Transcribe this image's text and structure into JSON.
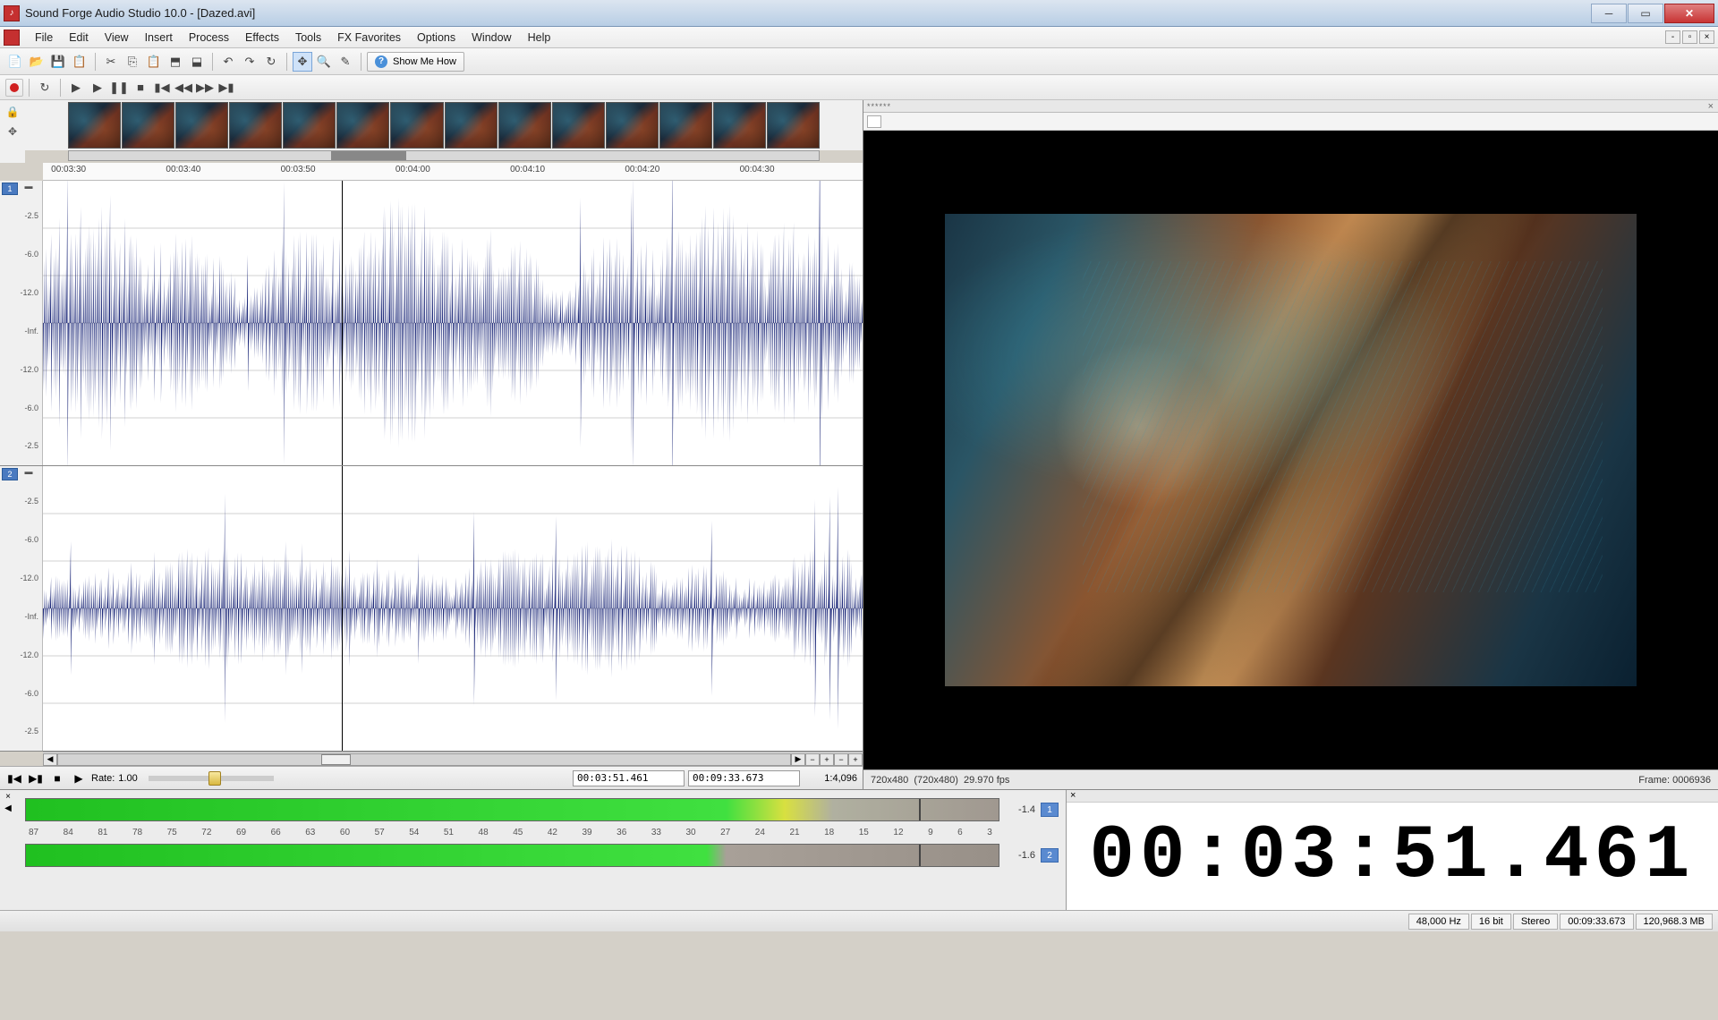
{
  "title": "Sound Forge Audio Studio 10.0 - [Dazed.avi]",
  "menu": [
    "File",
    "Edit",
    "View",
    "Insert",
    "Process",
    "Effects",
    "Tools",
    "FX Favorites",
    "Options",
    "Window",
    "Help"
  ],
  "toolbar": {
    "show_me_how": "Show Me How"
  },
  "timeline": {
    "ticks": [
      "00:03:30",
      "00:03:40",
      "00:03:50",
      "00:04:00",
      "00:04:10",
      "00:04:20",
      "00:04:30"
    ]
  },
  "dbscale": [
    "-2.5",
    "-6.0",
    "-12.0",
    "-Inf.",
    "-12.0",
    "-6.0",
    "-2.5"
  ],
  "channels": [
    "1",
    "2"
  ],
  "navbar": {
    "rate_label": "Rate:",
    "rate_value": "1.00",
    "pos_time": "00:03:51.461",
    "total_time": "00:09:33.673",
    "zoom": "1:4,096"
  },
  "video": {
    "header": "******",
    "res": "720x480",
    "res2": "(720x480)",
    "fps": "29.970 fps",
    "frame_label": "Frame:",
    "frame": "0006936"
  },
  "meters": {
    "peak1": "-1.4",
    "peak2": "-1.6",
    "ch": [
      "1",
      "2"
    ],
    "ticks": [
      "87",
      "84",
      "81",
      "78",
      "75",
      "72",
      "69",
      "66",
      "63",
      "60",
      "57",
      "54",
      "51",
      "48",
      "45",
      "42",
      "39",
      "36",
      "33",
      "30",
      "27",
      "24",
      "21",
      "18",
      "15",
      "12",
      "9",
      "6",
      "3"
    ]
  },
  "bigtime": "00:03:51.461",
  "status": {
    "rate": "48,000 Hz",
    "bits": "16 bit",
    "mode": "Stereo",
    "length": "00:09:33.673",
    "mem": "120,968.3 MB"
  }
}
